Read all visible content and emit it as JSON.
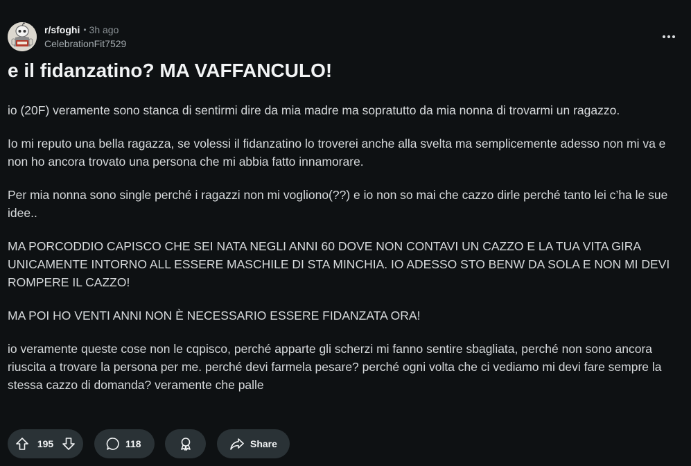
{
  "post": {
    "subreddit": "r/sfoghi",
    "time_ago": "3h ago",
    "author": "CelebrationFit7529",
    "title": "e il fidanzatino? MA VAFFANCULO!",
    "paragraphs": [
      "io (20F) veramente sono stanca di sentirmi dire da mia madre ma sopratutto da mia nonna di trovarmi un ragazzo.",
      "Io mi reputo una bella ragazza, se volessi il fidanzatino lo troverei anche alla svelta ma semplicemente adesso non mi va e non ho ancora trovato una persona che mi abbia fatto innamorare.",
      "Per mia nonna sono single perché i ragazzi non mi vogliono(??) e io non so mai che cazzo dirle perché tanto lei c’ha le sue idee..",
      "MA PORCODDIO CAPISCO CHE SEI NATA NEGLI ANNI 60 DOVE NON CONTAVI UN CAZZO E LA TUA VITA GIRA UNICAMENTE INTORNO ALL ESSERE MASCHILE DI STA MINCHIA. IO ADESSO STO BENW DA SOLA E NON MI DEVI ROMPERE IL CAZZO!",
      "MA POI HO VENTI ANNI NON È NECESSARIO ESSERE FIDANZATA ORA!",
      "io veramente queste cose non le cqpisco, perché apparte gli scherzi mi fanno sentire sbagliata, perché non sono ancora riuscita a trovare la persona per me. perché devi farmela pesare? perché ogni volta che ci vediamo mi devi fare sempre la stessa cazzo di domanda? veramente che palle"
    ]
  },
  "actions": {
    "votes": "195",
    "comments": "118",
    "share_label": "Share"
  },
  "icons": {
    "avatar": "snoo-avatar-icon",
    "more": "more-options-icon",
    "upvote": "upvote-arrow-icon",
    "downvote": "downvote-arrow-icon",
    "comment": "comment-bubble-icon",
    "award": "award-icon",
    "share": "share-arrow-icon"
  },
  "colors": {
    "background": "#0e1113",
    "pill": "#2a3236",
    "text": "#d7dadc",
    "meta": "#8b9296"
  }
}
